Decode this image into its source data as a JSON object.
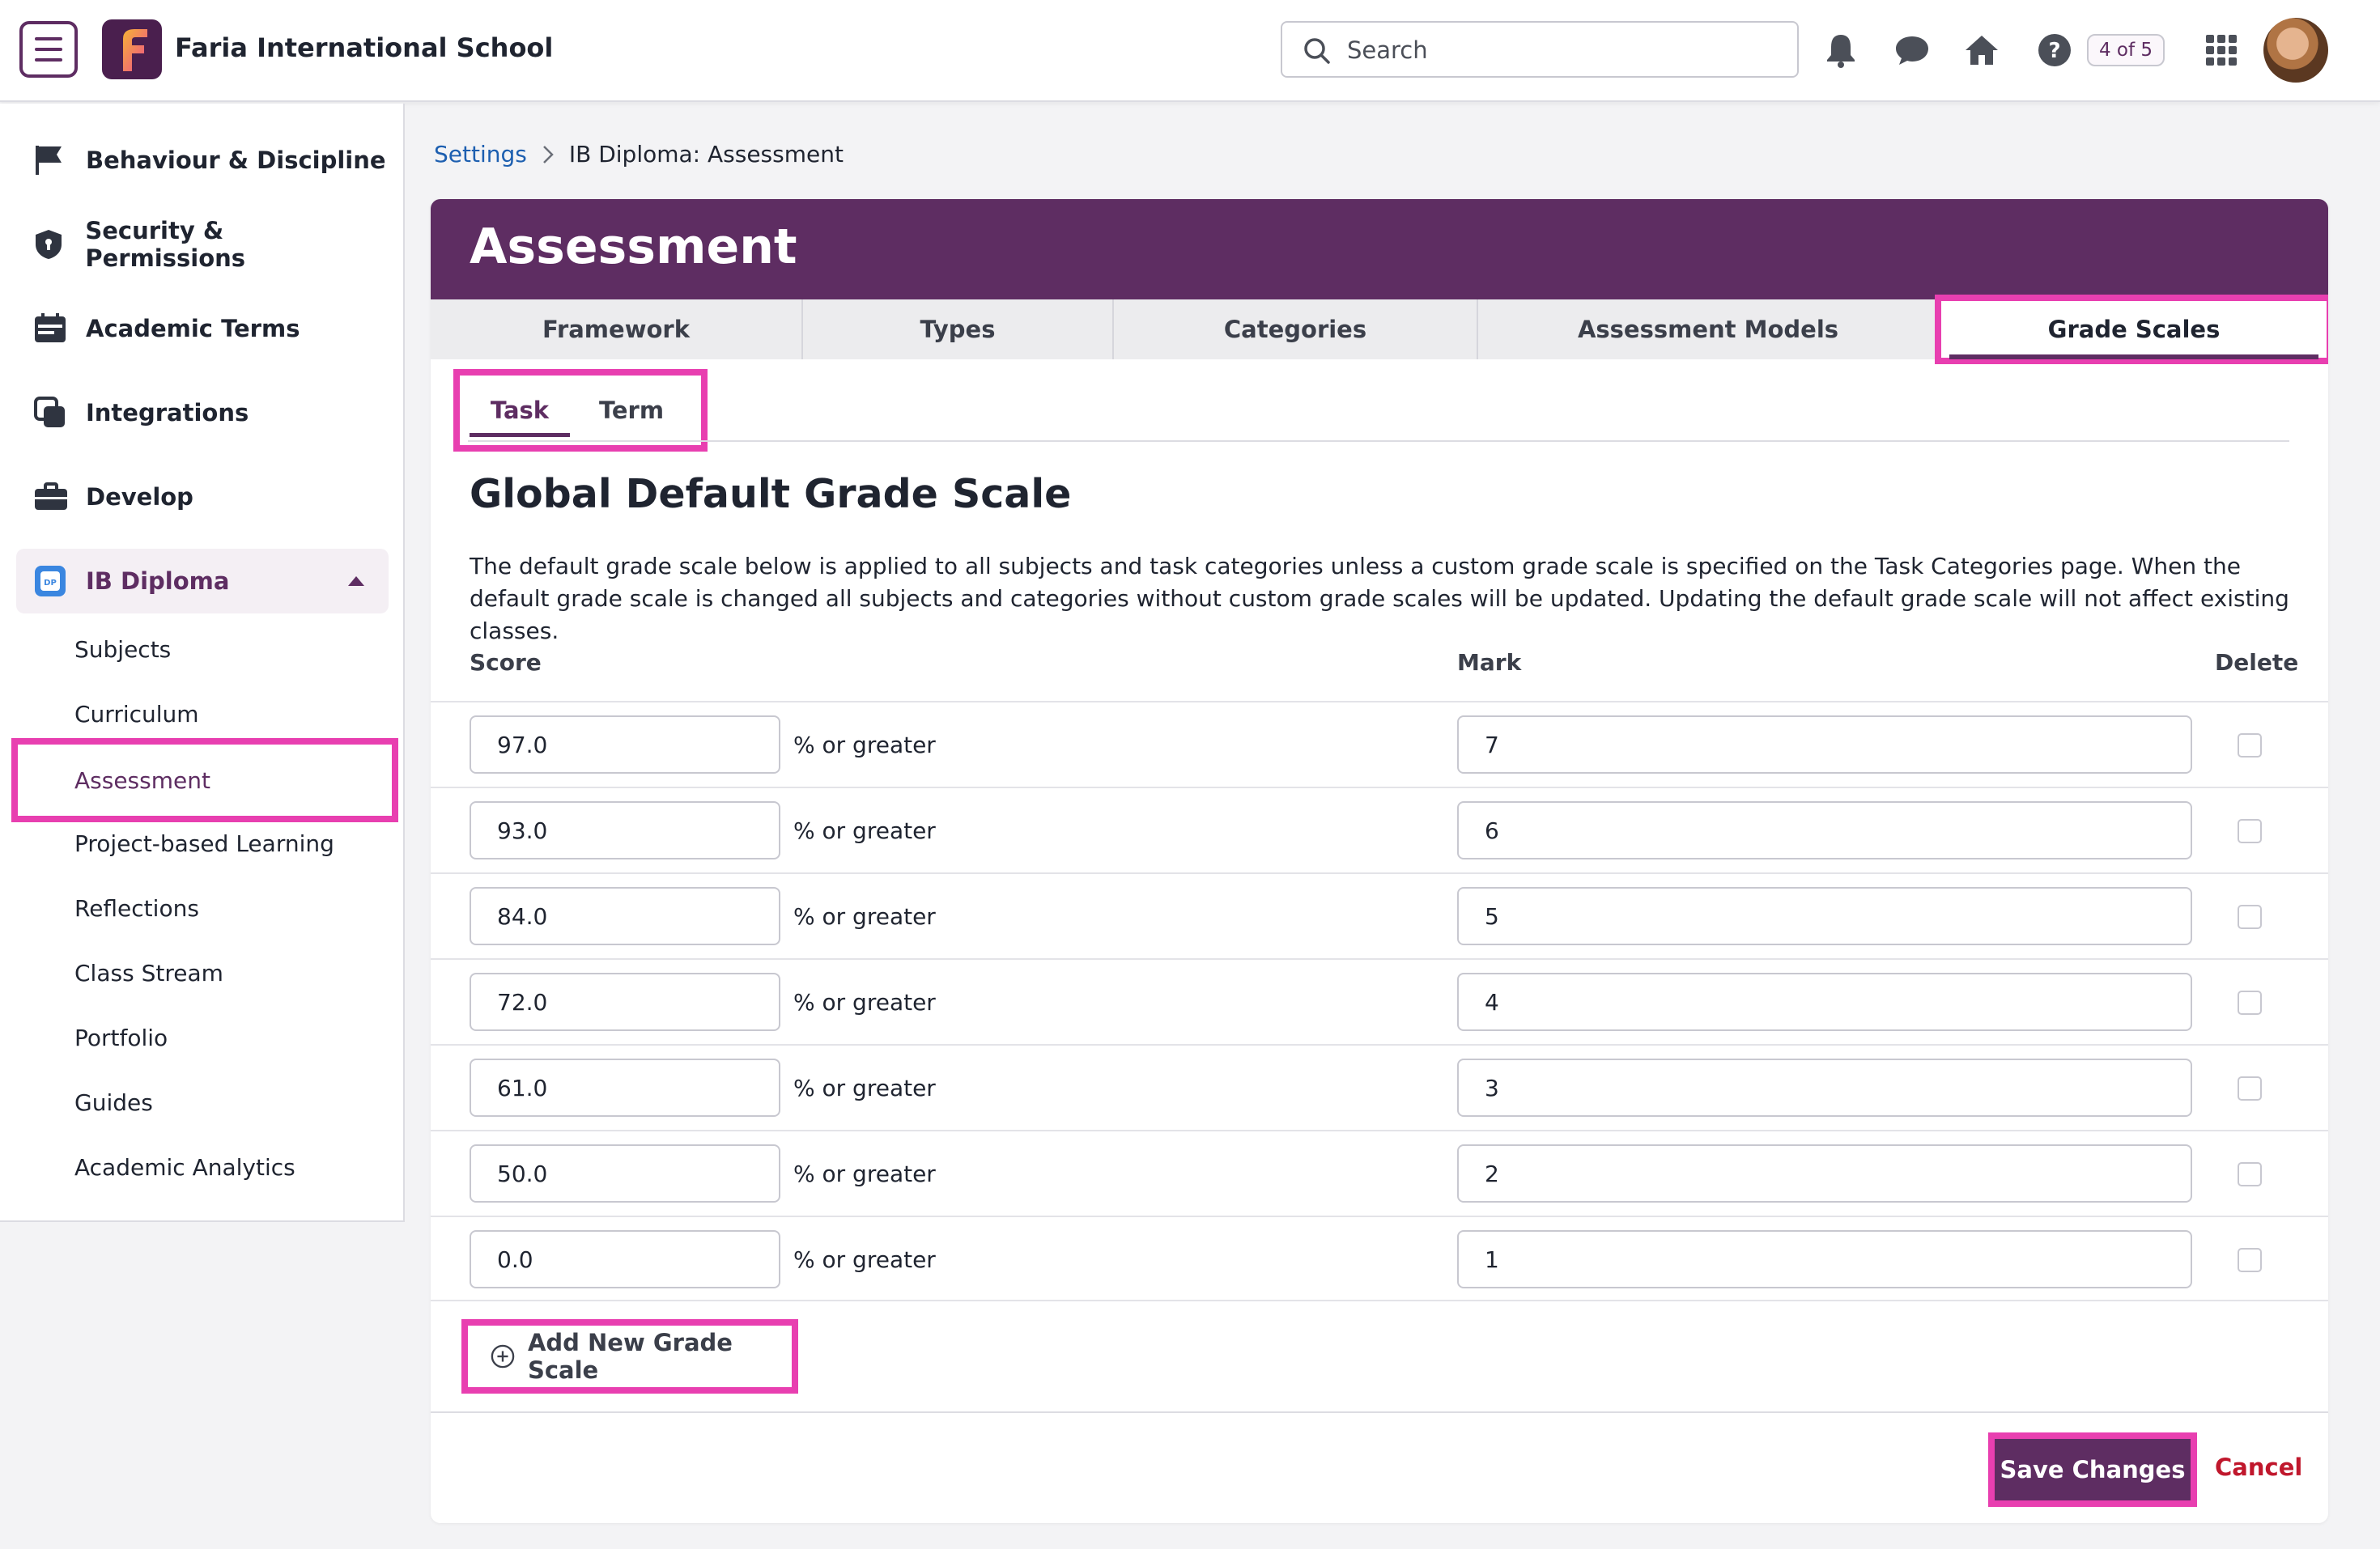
{
  "header": {
    "school_name": "Faria International School",
    "search_placeholder": "Search",
    "badge": "4 of 5"
  },
  "sidebar": {
    "items": [
      {
        "label": "Behaviour & Discipline",
        "icon": "flag-icon"
      },
      {
        "label": "Security & Permissions",
        "icon": "shield-icon"
      },
      {
        "label": "Academic Terms",
        "icon": "calendar-icon"
      },
      {
        "label": "Integrations",
        "icon": "integrations-icon"
      },
      {
        "label": "Develop",
        "icon": "briefcase-icon"
      },
      {
        "label": "IB Diploma",
        "icon": "dp-icon"
      }
    ],
    "subitems": [
      "Subjects",
      "Curriculum",
      "Assessment",
      "Project-based Learning",
      "Reflections",
      "Class Stream",
      "Portfolio",
      "Guides",
      "Academic Analytics"
    ]
  },
  "breadcrumb": {
    "parent": "Settings",
    "current": "IB Diploma: Assessment"
  },
  "card": {
    "title": "Assessment",
    "tabs": [
      "Framework",
      "Types",
      "Categories",
      "Assessment Models",
      "Grade Scales"
    ],
    "subtabs": [
      "Task",
      "Term"
    ],
    "section_title": "Global Default Grade Scale",
    "description": "The default grade scale below is applied to all subjects and task categories unless a custom grade scale is specified on the Task Categories page. When the default grade scale is changed all subjects and categories without custom grade scales will be updated. Updating the default grade scale will not affect existing classes.",
    "columns": {
      "score": "Score",
      "mark": "Mark",
      "delete": "Delete"
    },
    "suffix": "% or greater",
    "rows": [
      {
        "score": "97.0",
        "mark": "7"
      },
      {
        "score": "93.0",
        "mark": "6"
      },
      {
        "score": "84.0",
        "mark": "5"
      },
      {
        "score": "72.0",
        "mark": "4"
      },
      {
        "score": "61.0",
        "mark": "3"
      },
      {
        "score": "50.0",
        "mark": "2"
      },
      {
        "score": "0.0",
        "mark": "1"
      }
    ],
    "add_label": "Add New Grade Scale",
    "save_label": "Save Changes",
    "cancel_label": "Cancel"
  },
  "colors": {
    "brand": "#5e2d62",
    "highlight": "#e83fb0",
    "link": "#1d5fb0",
    "danger": "#c0172c"
  }
}
